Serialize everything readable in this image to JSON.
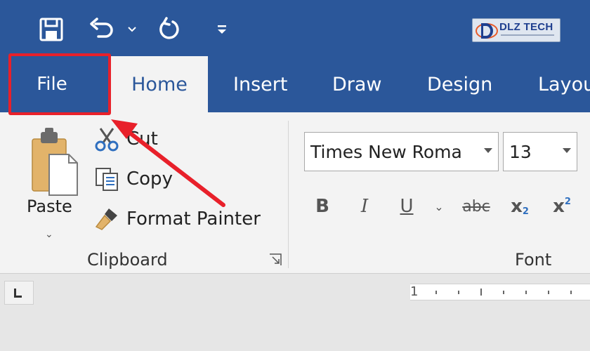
{
  "quick_access": {
    "save_icon": "save-icon",
    "undo_icon": "undo-icon",
    "undo_dropdown_icon": "chevron-down-icon",
    "redo_icon": "redo-icon",
    "customize_icon": "customize-qat-icon"
  },
  "logo": {
    "text": "DLZ TECH",
    "icon": "dlz-logo-icon"
  },
  "tabs": [
    {
      "label": "File"
    },
    {
      "label": "Home",
      "active": true
    },
    {
      "label": "Insert"
    },
    {
      "label": "Draw"
    },
    {
      "label": "Design"
    },
    {
      "label": "Layou"
    }
  ],
  "clipboard": {
    "paste_label": "Paste",
    "cut_label": "Cut",
    "copy_label": "Copy",
    "format_painter_label": "Format Painter",
    "group_label": "Clipboard"
  },
  "font": {
    "font_name": "Times New Roma",
    "font_size": "13",
    "bold_label": "B",
    "italic_label": "I",
    "underline_label": "U",
    "strikethrough_label": "abc",
    "subscript_label": "x",
    "superscript_label": "x",
    "subscript_mark": "2",
    "superscript_mark": "2",
    "group_label": "Font"
  },
  "ruler": {
    "label": "1"
  },
  "colors": {
    "brand_blue": "#2b579a",
    "highlight_red": "#e8202a",
    "ribbon_bg": "#f3f3f3"
  }
}
